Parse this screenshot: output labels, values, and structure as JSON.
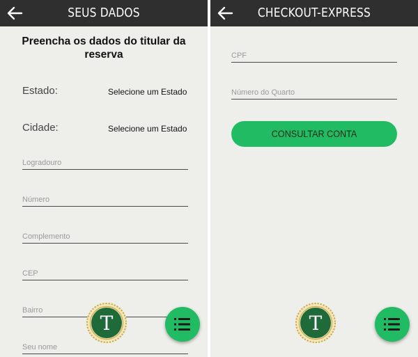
{
  "left_screen": {
    "title": "SEUS DADOS",
    "heading": "Preencha os dados do titular da reserva",
    "estado": {
      "label": "Estado:",
      "value": "Selecione um Estado"
    },
    "cidade": {
      "label": "Cidade:",
      "value": "Selecione um Estado"
    },
    "fields": [
      {
        "placeholder": "Logradouro"
      },
      {
        "placeholder": "Número"
      },
      {
        "placeholder": "Complemento"
      },
      {
        "placeholder": "CEP"
      },
      {
        "placeholder": "Bairro"
      },
      {
        "placeholder": "Seu nome"
      }
    ],
    "logo_letter": "T"
  },
  "right_screen": {
    "title": "CHECKOUT-EXPRESS",
    "fields": [
      {
        "placeholder": "CPF"
      },
      {
        "placeholder": "Número do Quarto"
      }
    ],
    "button_label": "CONSULTAR CONTA",
    "logo_letter": "T"
  },
  "icons": {
    "back": "arrow-left-icon",
    "menu": "menu-list-icon",
    "logo": "hotel-t-logo"
  },
  "colors": {
    "appbar": "#2f2f2f",
    "background": "#eeeeea",
    "accent_green": "#20bb62",
    "logo_green": "#1e6b39",
    "logo_gold": "#c9a64a"
  }
}
